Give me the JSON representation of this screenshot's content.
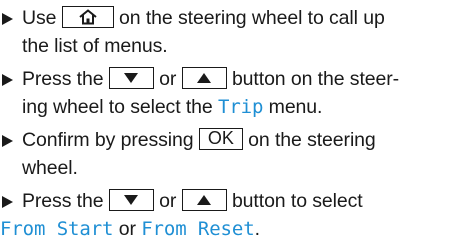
{
  "steps": [
    {
      "lines": [
        {
          "before": "Use",
          "after": "on the steering wheel to call up"
        },
        {
          "text": "the list of menus."
        }
      ]
    },
    {
      "lines": [
        {
          "before": "Press the",
          "middle": "or",
          "after": "button on the steer-"
        },
        {
          "before": "ing wheel to select the",
          "term": "Trip",
          "after": "menu."
        }
      ]
    },
    {
      "lines": [
        {
          "before": "Confirm by pressing",
          "ok": "OK",
          "after": "on the steering"
        },
        {
          "text": "wheel."
        }
      ]
    },
    {
      "lines": [
        {
          "before": "Press the",
          "middle": "or",
          "after": "button to select"
        },
        {
          "term1": "From Start",
          "middle": "or",
          "term2": "From Reset",
          "end": "."
        }
      ]
    }
  ],
  "icons": {
    "bullet": "triangle-bullet-icon",
    "home": "home-icon",
    "down": "down-arrow-icon",
    "up": "up-arrow-icon"
  },
  "colors": {
    "text": "#1a1a1a",
    "menu_term": "#1f8fd4"
  }
}
